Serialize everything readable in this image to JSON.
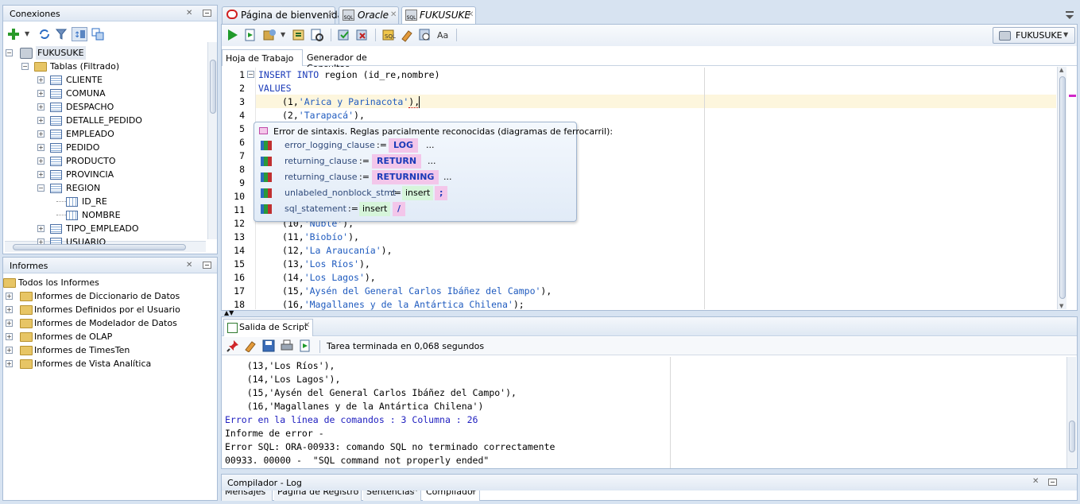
{
  "connections_panel": {
    "title": "Conexiones",
    "tree": {
      "root": "FUKUSUKE",
      "tables_node": "Tablas (Filtrado)",
      "tables": [
        "CLIENTE",
        "COMUNA",
        "DESPACHO",
        "DETALLE_PEDIDO",
        "EMPLEADO",
        "PEDIDO",
        "PRODUCTO",
        "PROVINCIA",
        "REGION"
      ],
      "region_columns": [
        "ID_RE",
        "NOMBRE"
      ],
      "tables_after": [
        "TIPO_EMPLEADO",
        "USUARIO"
      ]
    }
  },
  "reports_panel": {
    "title": "Informes",
    "items": [
      "Todos los Informes",
      "Informes de Diccionario de Datos",
      "Informes Definidos por el Usuario",
      "Informes de Modelador de Datos",
      "Informes de OLAP",
      "Informes de TimesTen",
      "Informes de Vista Analítica"
    ]
  },
  "tabs": [
    {
      "label": "Página de bienvenida",
      "active": false
    },
    {
      "label": "Oracle",
      "active": false
    },
    {
      "label": "FUKUSUKE",
      "active": true
    }
  ],
  "connection_selector": "FUKUSUKE",
  "subtabs": [
    "Hoja de Trabajo",
    "Generador de Consultas"
  ],
  "editor": {
    "line_numbers": [
      "1",
      "2",
      "3",
      "4",
      "5",
      "6",
      "7",
      "8",
      "9",
      "10",
      "11",
      "12",
      "13",
      "14",
      "15",
      "16",
      "17",
      "18"
    ],
    "line1_kw1": "INSERT",
    "line1_kw2": "INTO",
    "line1_rest": "region (id_re,nombre)",
    "line2_kw": "VALUES",
    "line3_pre": "(1,",
    "line3_str": "'Arica y Parinacota'",
    "line3_post": "),",
    "line4_pre": "(2,",
    "line4_str": "'Tarapacá'",
    "line4_post": "),",
    "visible_lines": [
      {
        "pre": "(10,",
        "str": "'Ñuble'",
        "post": "),"
      },
      {
        "pre": "(11,",
        "str": "'Biobío'",
        "post": "),"
      },
      {
        "pre": "(12,",
        "str": "'La Araucanía'",
        "post": "),"
      },
      {
        "pre": "(13,",
        "str": "'Los Ríos'",
        "post": "),"
      },
      {
        "pre": "(14,",
        "str": "'Los Lagos'",
        "post": "),"
      },
      {
        "pre": "(15,",
        "str": "'Aysén del General Carlos Ibáñez del Campo'",
        "post": "),"
      },
      {
        "pre": "(16,",
        "str": "'Magallanes y de la Antártica Chilena'",
        "post": ");"
      }
    ]
  },
  "syntax_popup": {
    "title": "Error de sintaxis. Reglas parcialmente reconocidas (diagramas de ferrocarril):",
    "rules": [
      {
        "name": "error_logging_clause",
        "assign": ":=",
        "token": "LOG",
        "tail": "..."
      },
      {
        "name": "returning_clause",
        "assign": ":=",
        "token": "RETURN",
        "tail": "..."
      },
      {
        "name": "returning_clause",
        "assign": ":=",
        "token": "RETURNING",
        "tail": "..."
      },
      {
        "name": "unlabeled_nonblock_stmt",
        "assign": ":=",
        "word": "insert",
        "token": ";"
      },
      {
        "name": "sql_statement",
        "assign": ":=",
        "word": "insert",
        "token": "/"
      }
    ]
  },
  "script_output": {
    "tab_label": "Salida de Script",
    "status": "Tarea terminada en 0,068 segundos",
    "lines": [
      "    (13,'Los Ríos'),",
      "    (14,'Los Lagos'),",
      "    (15,'Aysén del General Carlos Ibáñez del Campo'),",
      "    (16,'Magallanes y de la Antártica Chilena')",
      "Error en la línea de comandos : 3 Columna : 26",
      "Informe de error -",
      "Error SQL: ORA-00933: comando SQL no terminado correctamente",
      "00933. 00000 -  \"SQL command not properly ended\""
    ]
  },
  "log_panel": {
    "title": "Compilador - Log",
    "tabs": [
      "Mensajes",
      "Página de Registro",
      "Sentencias",
      "Compilador"
    ]
  },
  "colors": {
    "error_line": "#2020c0",
    "string": "#1f5bbf",
    "keyword": "#1a3ab8",
    "highlight_line": "#fdf6dd",
    "popup_token": "#f3c6ea"
  }
}
